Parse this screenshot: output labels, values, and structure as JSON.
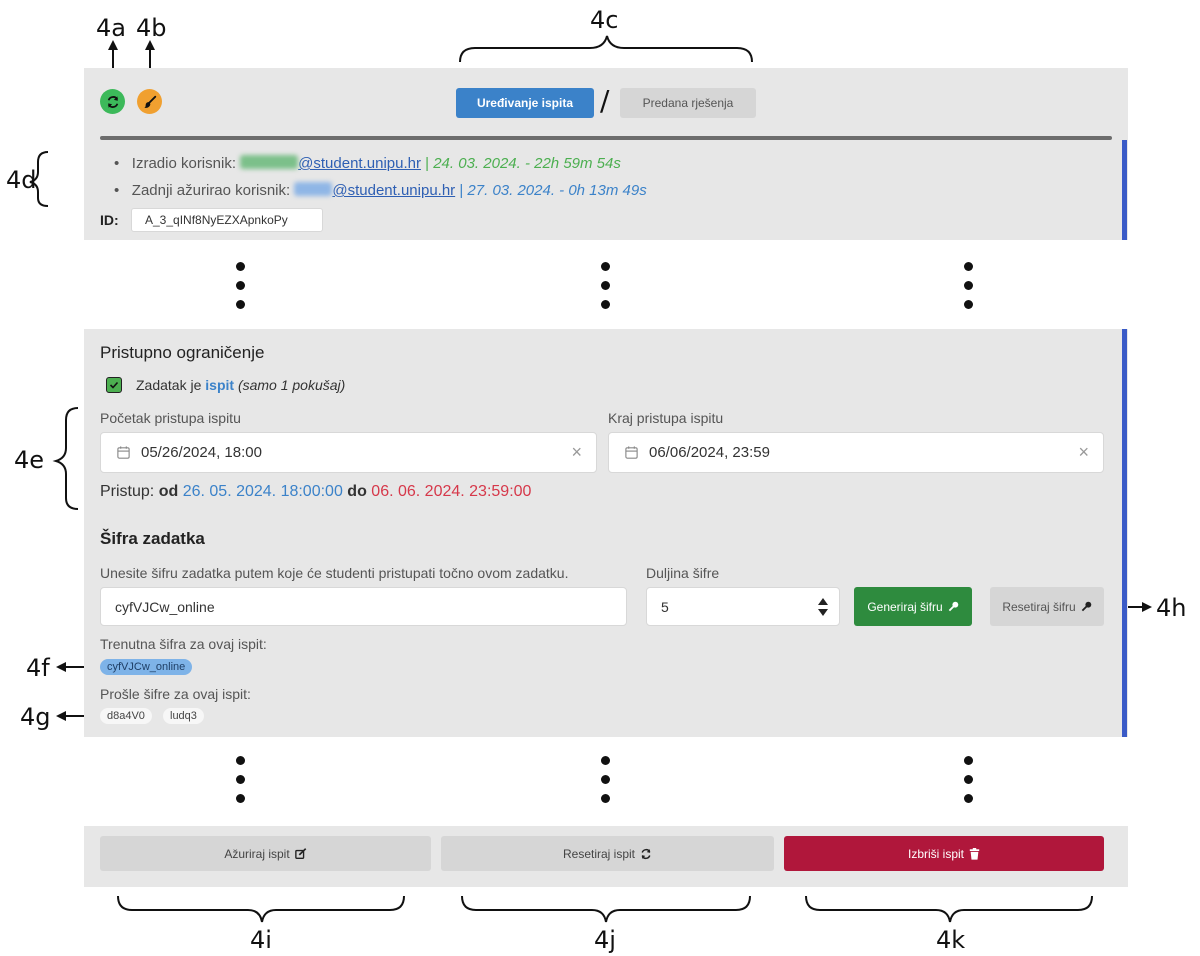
{
  "callouts": {
    "a": "4a",
    "b": "4b",
    "c": "4c",
    "d": "4d",
    "e": "4e",
    "f": "4f",
    "g": "4g",
    "h": "4h",
    "i": "4i",
    "j": "4j",
    "k": "4k"
  },
  "top": {
    "refresh_icon": "refresh-icon",
    "brush_icon": "brush-icon",
    "tab_edit": "Uređivanje ispita",
    "separator": "/",
    "tab_submitted": "Predana rješenja",
    "created_label": "Izradio korisnik:",
    "created_email": "@student.unipu.hr",
    "created_date": "24. 03. 2024. - 22h 59m 54s",
    "updated_label": "Zadnji ažurirao korisnik:",
    "updated_email": "@student.unipu.hr",
    "updated_date": "27. 03. 2024. - 0h 13m 49s",
    "pipe": "|",
    "bullet": "•",
    "id_label": "ID:",
    "id_value": "A_3_qINf8NyEZXApnkoPy"
  },
  "access": {
    "title": "Pristupno ograničenje",
    "checkbox_checked": true,
    "exam_text_pre": "Zadatak je",
    "exam_word": "ispit",
    "exam_note": "(samo 1 pokušaj)",
    "start_label": "Početak pristupa ispitu",
    "start_value": "05/26/2024, 18:00",
    "end_label": "Kraj pristupa ispitu",
    "end_value": "06/06/2024, 23:59",
    "summary_label": "Pristup:",
    "summary_from": "od",
    "summary_start": "26. 05. 2024. 18:00:00",
    "summary_to": "do",
    "summary_end": "06. 06. 2024. 23:59:00",
    "clear_symbol": "×",
    "calendar_icon": "calendar-icon"
  },
  "code": {
    "title": "Šifra zadatka",
    "instruction": "Unesite šifru zadatka putem koje će studenti pristupati točno ovom zadatku.",
    "length_label": "Duljina šifre",
    "code_value": "cyfVJCw_online",
    "length_value": "5",
    "generate_label": "Generiraj šifru",
    "reset_label": "Resetiraj šifru",
    "key_icon": "key-icon",
    "current_label": "Trenutna šifra za ovaj ispit:",
    "current_code": "cyfVJCw_online",
    "past_label": "Prošle šifre za ovaj ispit:",
    "past_codes": [
      "d8a4V0",
      "ludq3"
    ]
  },
  "actions": {
    "update_label": "Ažuriraj ispit",
    "reset_label": "Resetiraj ispit",
    "delete_label": "Izbriši ispit",
    "edit_icon": "edit-icon",
    "refresh_icon": "refresh-icon",
    "trash_icon": "trash-icon"
  },
  "colors": {
    "panel_bg": "#e7e7e7",
    "accent_blue": "#3a5bc7",
    "primary_blue": "#3b82c9",
    "success_green": "#2e8b3e",
    "danger_red": "#b0173b",
    "date_blue": "#3b82c9",
    "date_red": "#d6384a",
    "created_green": "#4caf50",
    "updated_blue": "#3b82c9"
  }
}
